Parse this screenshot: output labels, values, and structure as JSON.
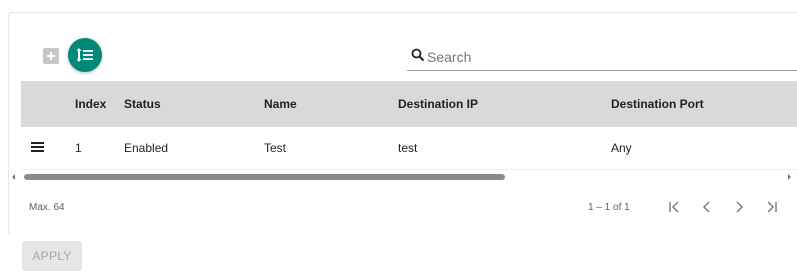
{
  "toolbar": {
    "add_icon": "plus-box-icon",
    "reorder_icon": "sort-list-icon",
    "accent_color": "#00897b"
  },
  "search": {
    "placeholder": "Search",
    "value": "",
    "icon": "search-icon"
  },
  "table": {
    "columns": [
      "Index",
      "Status",
      "Name",
      "Destination IP",
      "Destination Port"
    ],
    "rows": [
      {
        "drag_icon": "drag-handle-icon",
        "index": "1",
        "status": "Enabled",
        "name": "Test",
        "destination_ip": "test",
        "destination_port": "Any"
      }
    ],
    "scroll": {
      "thumb_fraction": 0.63
    }
  },
  "footer": {
    "max_label": "Max. 64",
    "page_range": "1 – 1 of 1"
  },
  "apply_label": "APPLY"
}
